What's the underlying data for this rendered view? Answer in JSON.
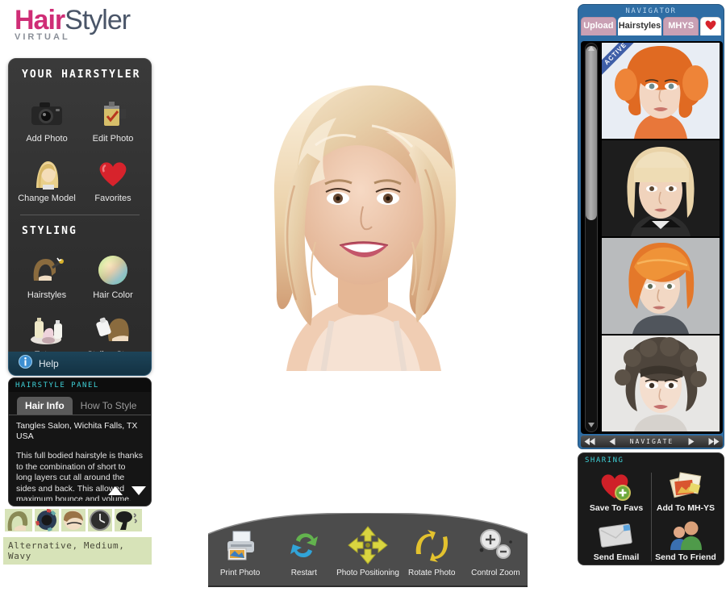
{
  "logo": {
    "brand_primary": "Hair",
    "brand_secondary": "Styler",
    "subtitle": "VIRTUAL",
    "color_primary": "#cf2d76",
    "color_secondary": "#4a5568"
  },
  "left_panel": {
    "section1_title": "YOUR HAIRSTYLER",
    "section1_items": [
      {
        "label": "Add Photo",
        "icon": "camera-icon"
      },
      {
        "label": "Edit Photo",
        "icon": "film-canister-icon"
      },
      {
        "label": "Change Model",
        "icon": "model-head-icon"
      },
      {
        "label": "Favorites",
        "icon": "heart-icon"
      }
    ],
    "section2_title": "STYLING",
    "section2_items": [
      {
        "label": "Hairstyles",
        "icon": "hairstyles-icon"
      },
      {
        "label": "Hair Color",
        "icon": "color-wheel-icon"
      },
      {
        "label": "Extras",
        "icon": "bottles-icon"
      },
      {
        "label": "Styling Steps",
        "icon": "styling-steps-icon"
      }
    ],
    "help_label": "Help",
    "help_icon": "info-icon"
  },
  "hairstyle_panel": {
    "header": "HAIRSTYLE PANEL",
    "tabs": [
      {
        "label": "Hair Info",
        "active": true
      },
      {
        "label": "How To Style",
        "active": false
      }
    ],
    "salon": "Tangles Salon, Wichita Falls, TX USA",
    "description": " This full bodied hairstyle is thanks to the combination of short to long layers cut all around the sides and back. This allowed maximum bounce and volume. The vibrant",
    "scroll_up_icon": "triangle-up-icon",
    "scroll_down_icon": "triangle-down-icon"
  },
  "attributes": {
    "text": "Alternative, Medium, Wavy",
    "icons": [
      "hair-style-icon",
      "color-wheel-icon",
      "hair-length-icon",
      "time-clock-icon",
      "hairdryer-icon"
    ]
  },
  "toolbar": {
    "items": [
      {
        "label": "Print Photo",
        "icon": "printer-icon"
      },
      {
        "label": "Restart",
        "icon": "restart-arrows-icon"
      },
      {
        "label": "Photo Positioning",
        "icon": "four-way-arrows-icon"
      },
      {
        "label": "Rotate Photo",
        "icon": "rotate-arrows-icon"
      },
      {
        "label": "Control Zoom",
        "icon": "zoom-plus-minus-icon"
      }
    ]
  },
  "navigator": {
    "header": "NAVIGATOR",
    "tabs": [
      {
        "label": "Upload",
        "active": false
      },
      {
        "label": "Hairstyles",
        "active": true
      },
      {
        "label": "MHYS",
        "active": false
      },
      {
        "label": "",
        "icon": "heart-icon",
        "active": false
      }
    ],
    "thumbnails": [
      {
        "badge": "ACTIVE",
        "description": "orange curly bob model"
      },
      {
        "badge": "",
        "description": "blonde straight bob with fringe model"
      },
      {
        "badge": "",
        "description": "copper red pixie cut model"
      },
      {
        "badge": "",
        "description": "dark brown curly short hair model"
      }
    ],
    "navigate_label": "NAVIGATE",
    "nav_buttons": [
      "first-icon",
      "previous-icon",
      "next-icon",
      "last-icon"
    ],
    "scrollbar": {
      "up_icon": "scroll-up-icon",
      "down_icon": "scroll-down-icon"
    }
  },
  "sharing": {
    "header": "SHARING",
    "items": [
      {
        "label": "Save To Favs",
        "icon": "heart-plus-icon"
      },
      {
        "label": "Add To MH-YS",
        "icon": "photos-icon"
      },
      {
        "label": "Send Email",
        "icon": "envelope-icon"
      },
      {
        "label": "Send To Friend",
        "icon": "people-icon"
      }
    ]
  },
  "photo": {
    "description": "blonde wavy medium-length hairstyle on smiling model"
  }
}
